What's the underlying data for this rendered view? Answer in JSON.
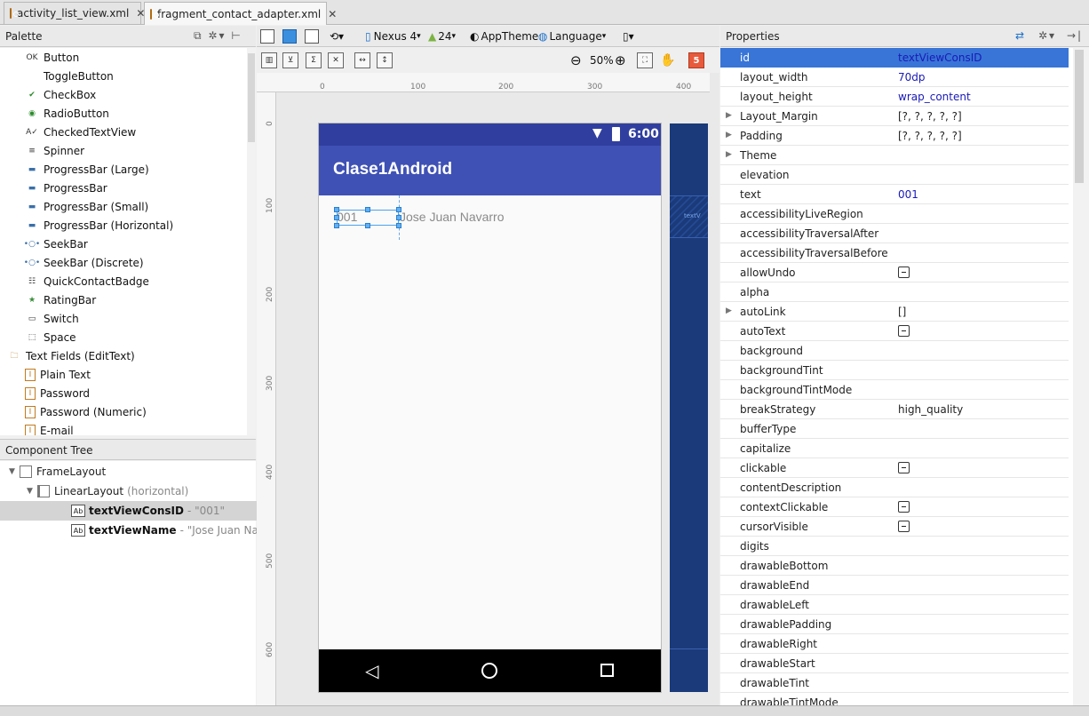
{
  "tabs": [
    {
      "label": "activity_list_view.xml",
      "active": false
    },
    {
      "label": "fragment_contact_adapter.xml",
      "active": true
    }
  ],
  "palette": {
    "title": "Palette",
    "items": [
      {
        "label": "Button",
        "icon": "button-icon",
        "glyph": "OK"
      },
      {
        "label": "ToggleButton",
        "icon": "toggle-button-icon",
        "glyph": ""
      },
      {
        "label": "CheckBox",
        "icon": "checkbox-icon",
        "glyph": "✔"
      },
      {
        "label": "RadioButton",
        "icon": "radio-button-icon",
        "glyph": "◉"
      },
      {
        "label": "CheckedTextView",
        "icon": "checked-textview-icon",
        "glyph": "A✓"
      },
      {
        "label": "Spinner",
        "icon": "spinner-icon",
        "glyph": "≡"
      },
      {
        "label": "ProgressBar (Large)",
        "icon": "progressbar-icon",
        "glyph": "▬"
      },
      {
        "label": "ProgressBar",
        "icon": "progressbar-icon",
        "glyph": "▬"
      },
      {
        "label": "ProgressBar (Small)",
        "icon": "progressbar-icon",
        "glyph": "▬"
      },
      {
        "label": "ProgressBar (Horizontal)",
        "icon": "progressbar-icon",
        "glyph": "▬"
      },
      {
        "label": "SeekBar",
        "icon": "seekbar-icon",
        "glyph": "•○•"
      },
      {
        "label": "SeekBar (Discrete)",
        "icon": "seekbar-icon",
        "glyph": "•○•"
      },
      {
        "label": "QuickContactBadge",
        "icon": "contact-badge-icon",
        "glyph": "☷"
      },
      {
        "label": "RatingBar",
        "icon": "star-icon",
        "glyph": "★"
      },
      {
        "label": "Switch",
        "icon": "switch-icon",
        "glyph": "▭"
      },
      {
        "label": "Space",
        "icon": "space-icon",
        "glyph": "⬚"
      },
      {
        "label": "Text Fields (EditText)",
        "icon": "folder-icon",
        "glyph": "🗀",
        "folder": true
      },
      {
        "label": "Plain Text",
        "icon": "text-field-icon",
        "glyph": "I"
      },
      {
        "label": "Password",
        "icon": "text-field-icon",
        "glyph": "I"
      },
      {
        "label": "Password (Numeric)",
        "icon": "text-field-icon",
        "glyph": "I"
      },
      {
        "label": "E-mail",
        "icon": "text-field-icon",
        "glyph": "I"
      }
    ]
  },
  "component_tree": {
    "title": "Component Tree",
    "rows": [
      {
        "label": "FrameLayout",
        "extra": "",
        "depth": 0,
        "bold": false,
        "selected": false,
        "icon": "frame-layout-icon"
      },
      {
        "label": "LinearLayout",
        "extra": "(horizontal)",
        "depth": 1,
        "bold": false,
        "selected": false,
        "icon": "linear-layout-icon"
      },
      {
        "label": "textViewConsID",
        "extra": "- \"001\"",
        "depth": 2,
        "bold": true,
        "selected": true,
        "icon": "textview-icon"
      },
      {
        "label": "textViewName",
        "extra": "- \"Jose Juan Navarro\"",
        "depth": 2,
        "bold": true,
        "selected": false,
        "icon": "textview-icon"
      }
    ]
  },
  "toolbar": {
    "device": "Nexus 4",
    "api": "24",
    "theme": "AppTheme",
    "language": "Language",
    "zoom": "50%",
    "error_count": "5"
  },
  "rulers": {
    "top": [
      "0",
      "100",
      "200",
      "300",
      "400"
    ],
    "left": [
      "0",
      "100",
      "200",
      "300",
      "400",
      "500",
      "600"
    ]
  },
  "device_preview": {
    "time": "6:00",
    "app_title": "Clase1Android",
    "field_id": "001",
    "field_name": "Jose Juan Navarro",
    "blueprint_label": "textV",
    "colors": {
      "primary": "#3f51b5",
      "primary_dark": "#303f9f"
    }
  },
  "properties": {
    "title": "Properties",
    "rows": [
      {
        "name": "id",
        "value": "textViewConsID",
        "selected": true
      },
      {
        "name": "layout_width",
        "value": "70dp"
      },
      {
        "name": "layout_height",
        "value": "wrap_content"
      },
      {
        "name": "Layout_Margin",
        "value": "[?, ?, ?, ?, ?]",
        "expandable": true,
        "dark": true
      },
      {
        "name": "Padding",
        "value": "[?, ?, ?, ?, ?]",
        "expandable": true,
        "dark": true
      },
      {
        "name": "Theme",
        "value": "",
        "expandable": true
      },
      {
        "name": "elevation",
        "value": ""
      },
      {
        "name": "text",
        "value": "001"
      },
      {
        "name": "accessibilityLiveRegion",
        "value": ""
      },
      {
        "name": "accessibilityTraversalAfter",
        "value": ""
      },
      {
        "name": "accessibilityTraversalBefore",
        "value": ""
      },
      {
        "name": "allowUndo",
        "value": "",
        "checkbox": true
      },
      {
        "name": "alpha",
        "value": ""
      },
      {
        "name": "autoLink",
        "value": "[]",
        "expandable": true,
        "dark": true
      },
      {
        "name": "autoText",
        "value": "",
        "checkbox": true
      },
      {
        "name": "background",
        "value": ""
      },
      {
        "name": "backgroundTint",
        "value": ""
      },
      {
        "name": "backgroundTintMode",
        "value": ""
      },
      {
        "name": "breakStrategy",
        "value": "high_quality",
        "dark": true
      },
      {
        "name": "bufferType",
        "value": ""
      },
      {
        "name": "capitalize",
        "value": ""
      },
      {
        "name": "clickable",
        "value": "",
        "checkbox": true
      },
      {
        "name": "contentDescription",
        "value": ""
      },
      {
        "name": "contextClickable",
        "value": "",
        "checkbox": true
      },
      {
        "name": "cursorVisible",
        "value": "",
        "checkbox": true
      },
      {
        "name": "digits",
        "value": ""
      },
      {
        "name": "drawableBottom",
        "value": ""
      },
      {
        "name": "drawableEnd",
        "value": ""
      },
      {
        "name": "drawableLeft",
        "value": ""
      },
      {
        "name": "drawablePadding",
        "value": ""
      },
      {
        "name": "drawableRight",
        "value": ""
      },
      {
        "name": "drawableStart",
        "value": ""
      },
      {
        "name": "drawableTint",
        "value": ""
      },
      {
        "name": "drawableTintMode",
        "value": ""
      }
    ]
  }
}
